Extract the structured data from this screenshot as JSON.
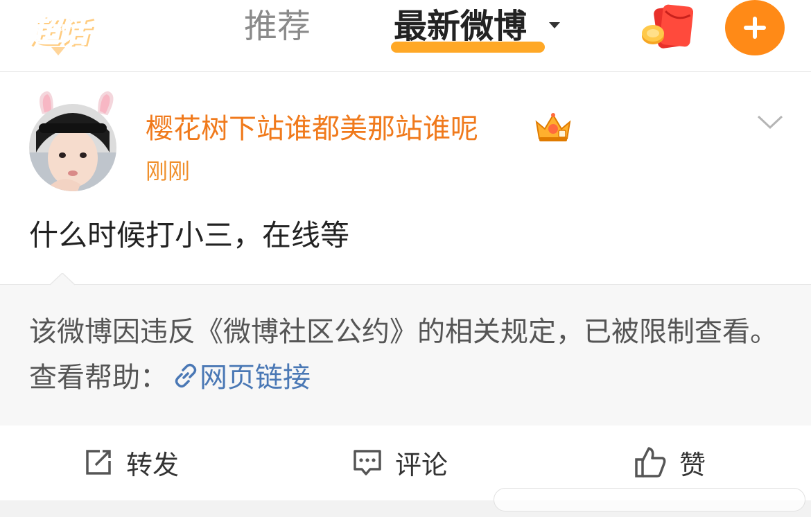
{
  "header": {
    "logo_label": "超话",
    "tabs": [
      {
        "label": "推荐",
        "active": false
      },
      {
        "label": "最新微博",
        "active": true
      }
    ],
    "accent_color": "#ff8a17"
  },
  "post": {
    "username": "樱花树下站谁都美那站谁呢",
    "time": "刚刚",
    "text": "什么时候打小三，在线等",
    "username_color": "#f07a1c"
  },
  "notice": {
    "text": "该微博因违反《微博社区公约》的相关规定，已被限制查看。查看帮助：",
    "link_label": "网页链接",
    "link_color": "#4a78b5"
  },
  "actions": {
    "repost_label": "转发",
    "comment_label": "评论",
    "like_label": "赞"
  },
  "icons": [
    "chaohua-logo",
    "caret-down-icon",
    "red-packet-icon",
    "plus-icon",
    "crown-badge-icon",
    "chevron-down-icon",
    "link-icon",
    "repost-icon",
    "comment-icon",
    "like-icon"
  ]
}
